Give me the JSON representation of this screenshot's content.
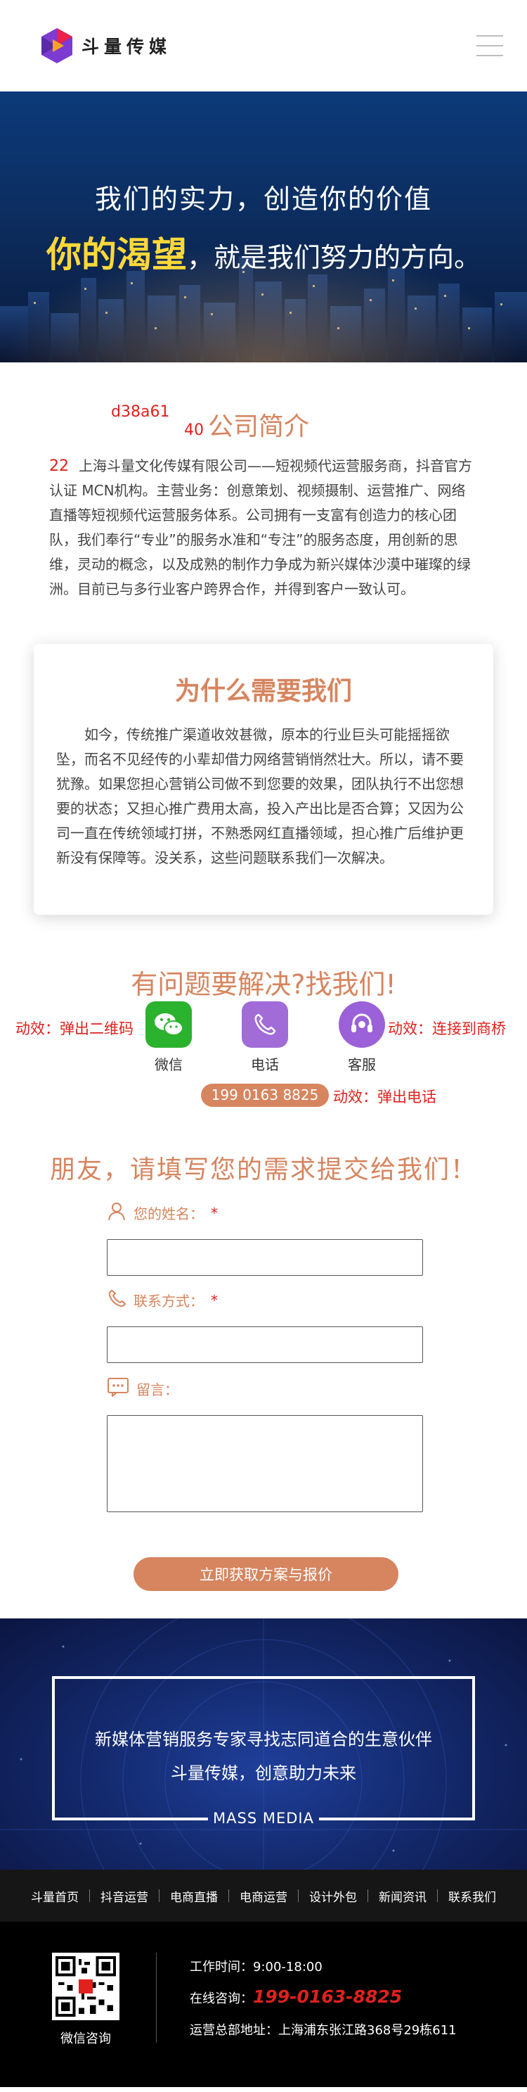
{
  "header": {
    "brand_name": "斗量传媒",
    "colors": {
      "logo_purple": "#7d3bd1",
      "logo_red": "#e9234a",
      "logo_orange": "#f6a623"
    }
  },
  "banner": {
    "line1": "我们的实力，创造你的价值",
    "highlight": "你的渴望",
    "line2_rest": "，就是我们努力的方向。"
  },
  "intro": {
    "code": "d38a61",
    "heading_num": "40",
    "title": "公司简介",
    "lead_num": "22",
    "body": "上海斗量文化传媒有限公司——短视频代运营服务商，抖音官方认证 MCN机构。主营业务：创意策划、视频摄制、运营推广、网络直播等短视频代运营服务体系。公司拥有一支富有创造力的核心团队，我们奉行“专业”的服务水准和“专注”的服务态度，用创新的思维，灵动的概念，以及成熟的制作力争成为新兴媒体沙漠中璀璨的绿洲。目前已与多行业客户跨界合作，并得到客户一致认可。"
  },
  "why": {
    "title": "为什么需要我们",
    "body": "如今，传统推广渠道收效甚微，原本的行业巨头可能摇摇欲坠，而名不见经传的小辈却借力网络营销悄然壮大。所以，请不要犹豫。如果您担心营销公司做不到您要的效果，团队执行不出您想要的状态；又担心推广费用太高，投入产出比是否合算；又因为公司一直在传统领域打拼，不熟悉网红直播领域，担心推广后维护更新没有保障等。没关系，这些问题联系我们一次解决。"
  },
  "contact": {
    "title": "有问题要解决?找我们!",
    "anno_wechat": "动效：弹出二维码",
    "anno_service": "动效：连接到商桥",
    "anno_phone": "动效：弹出电话",
    "wechat_label": "微信",
    "phone_label": "电话",
    "service_label": "客服",
    "phone_number": "199 0163 8825",
    "colors": {
      "wechat": "#2bb22f",
      "phone": "#a16bd8",
      "service": "#9b61d8"
    }
  },
  "form": {
    "title": "朋友，请填写您的需求提交给我们！",
    "name_label": "您的姓名：",
    "phone_label": "联系方式：",
    "message_label": "留言：",
    "required_mark": "*",
    "name_value": "",
    "phone_value": "",
    "message_value": "",
    "submit_label": "立即获取方案与报价"
  },
  "slogan": {
    "line1": "新媒体营销服务专家寻找志同道合的生意伙伴",
    "line2": "斗量传媒，创意助力未来",
    "tag": "MASS MEDIA"
  },
  "footer": {
    "nav": [
      "斗量首页",
      "抖音运营",
      "电商直播",
      "电商运营",
      "设计外包",
      "新闻资讯",
      "联系我们"
    ],
    "qr_caption": "微信咨询",
    "hours": "工作时间：9:00-18:00",
    "hotline_label": "在线咨询：",
    "hotline": "199-0163-8825",
    "address": "运营总部地址：上海浦东张江路368号29栋611"
  }
}
